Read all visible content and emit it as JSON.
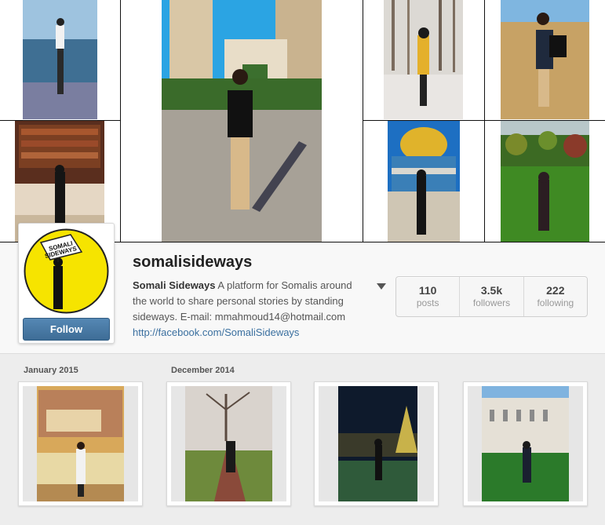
{
  "profile": {
    "username": "somalisideways",
    "display_name": "Somali Sideways",
    "bio": " A platform for Somalis around the world to share personal stories by standing sideways. E-mail: mmahmoud14@hotmail.com",
    "link": "http://facebook.com/SomaliSideways",
    "follow_label": "Follow",
    "logo_text": "SOMALI SIDEWAYS"
  },
  "stats": [
    {
      "value": "110",
      "label": "posts"
    },
    {
      "value": "3.5k",
      "label": "followers"
    },
    {
      "value": "222",
      "label": "following"
    }
  ],
  "feed": {
    "months": [
      "January 2015",
      "December 2014"
    ]
  },
  "colors": {
    "follow_button": "#4a7aa6",
    "link": "#3a6f9f",
    "logo_yellow": "#f6e400"
  },
  "icons": {
    "more": "caret-down-icon"
  }
}
